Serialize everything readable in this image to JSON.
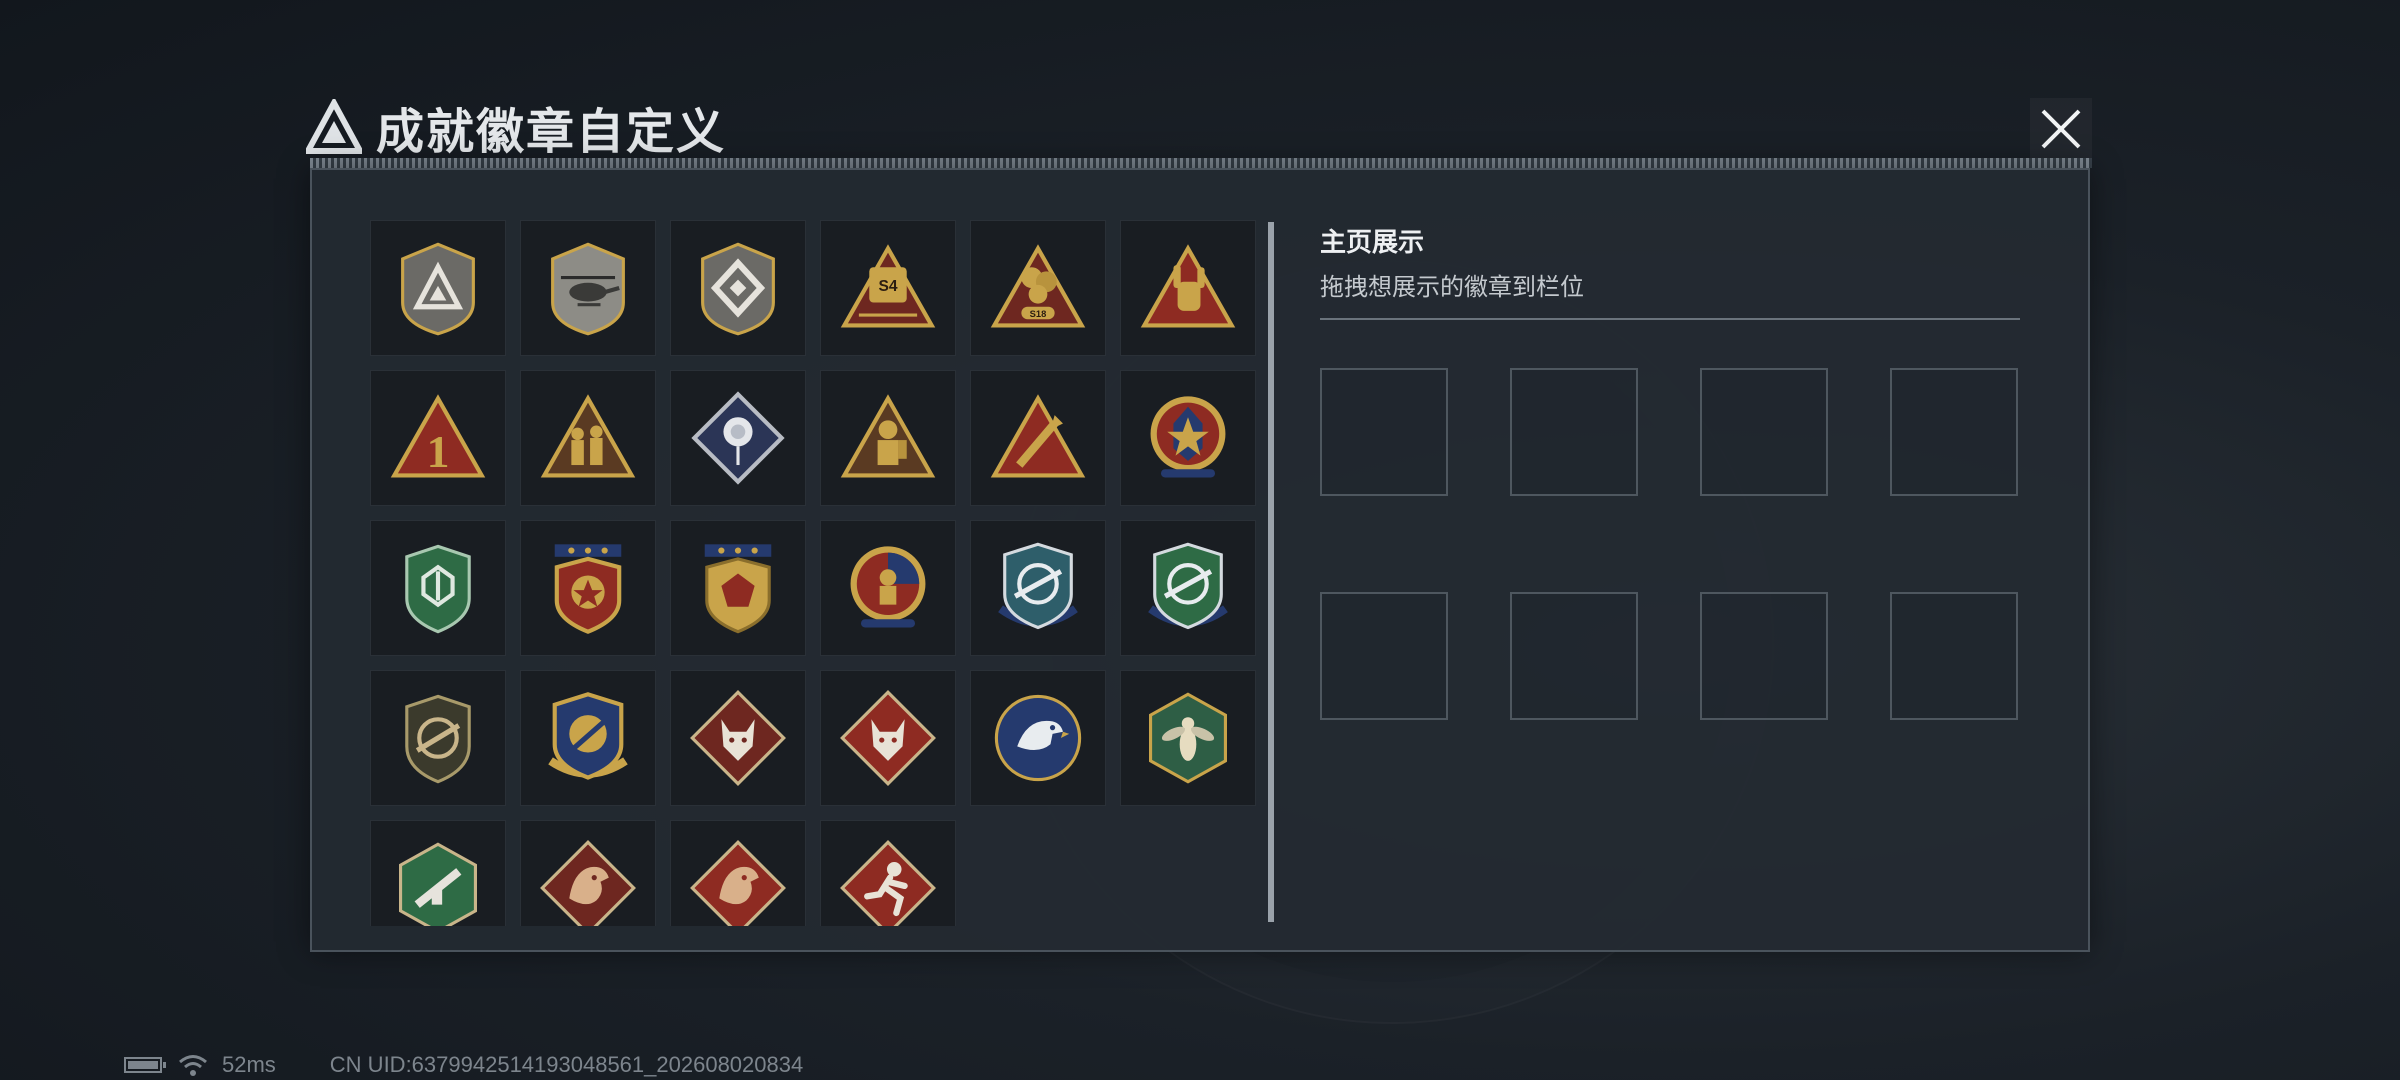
{
  "header": {
    "title": "成就徽章自定义",
    "logo_icon": "triangle-logo-icon",
    "close_icon": "close-icon"
  },
  "badge_list": {
    "badges": [
      {
        "icon": "triangle-shield-badge-icon"
      },
      {
        "icon": "helicopter-shield-badge-icon"
      },
      {
        "icon": "diamond-emblem-shield-badge-icon"
      },
      {
        "icon": "s4-triangle-badge-icon",
        "label": "S4"
      },
      {
        "icon": "s18-triangle-badge-icon",
        "label": "S18"
      },
      {
        "icon": "hand-sign-triangle-badge-icon"
      },
      {
        "icon": "number-one-triangle-badge-icon",
        "label": "1"
      },
      {
        "icon": "soldiers-triangle-badge-icon"
      },
      {
        "icon": "rose-diamond-badge-icon"
      },
      {
        "icon": "diver-triangle-badge-icon"
      },
      {
        "icon": "rocket-triangle-badge-icon"
      },
      {
        "icon": "star-medal-badge-icon"
      },
      {
        "icon": "green-shield-badge-icon"
      },
      {
        "icon": "gold-star-shield-badge-icon"
      },
      {
        "icon": "red-gem-shield-badge-icon"
      },
      {
        "icon": "soldier-round-medal-badge-icon"
      },
      {
        "icon": "rifle-crosshair-shield-badge-icon"
      },
      {
        "icon": "rifle-crosshair-shield-badge-2-icon"
      },
      {
        "icon": "rifle-olive-shield-badge-icon"
      },
      {
        "icon": "crosshair-gold-shield-badge-icon"
      },
      {
        "icon": "wolf-diamond-badge-icon"
      },
      {
        "icon": "wolf-diamond-badge-2-icon"
      },
      {
        "icon": "eagle-round-badge-icon"
      },
      {
        "icon": "hornet-hexagon-badge-icon"
      },
      {
        "icon": "weapon-green-hexagon-badge-icon"
      },
      {
        "icon": "dragon-diamond-badge-icon"
      },
      {
        "icon": "dragon-diamond-badge-2-icon"
      },
      {
        "icon": "runner-diamond-badge-icon"
      }
    ]
  },
  "showcase": {
    "title": "主页展示",
    "subtitle": "拖拽想展示的徽章到栏位",
    "slot_count": 8
  },
  "status_bar": {
    "battery_icon": "battery-icon",
    "wifi_icon": "wifi-icon",
    "latency": "52ms",
    "uid": "CN UID:6379942514193048561_202608020834"
  },
  "colors": {
    "gold": "#c9a44a",
    "red": "#8e2b22",
    "dark_red": "#6e2720",
    "green": "#2e6b45",
    "navy": "#253a6e",
    "steel": "#8d8c86",
    "panel_bg": "#242a31"
  }
}
